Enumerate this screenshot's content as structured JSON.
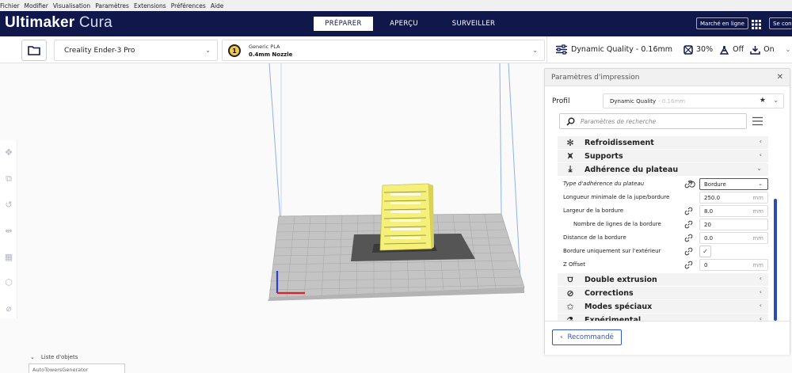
{
  "menu": [
    "Fichier",
    "Modifier",
    "Visualisation",
    "Paramètres",
    "Extensions",
    "Préférences",
    "Aide"
  ],
  "brand": {
    "name": "Ultimaker",
    "product": "Cura"
  },
  "stages": [
    {
      "label": "PRÉPARER",
      "active": true
    },
    {
      "label": "APERÇU",
      "active": false
    },
    {
      "label": "SURVEILLER",
      "active": false
    }
  ],
  "header_buttons": {
    "marketplace": "Marché en ligne",
    "signin": "Se conn"
  },
  "printer": {
    "name": "Creality Ender-3 Pro"
  },
  "material": {
    "extruder": "1",
    "name": "Generic PLA",
    "nozzle": "0.4mm Nozzle"
  },
  "print_summary": {
    "profile": "Dynamic Quality - 0.16mm",
    "infill": "30%",
    "support": "Off",
    "adhesion": "On"
  },
  "panel": {
    "title": "Paramètres d'impression",
    "profile_label": "Profil",
    "profile_value": "Dynamic Quality",
    "profile_suffix": "- 0.16mm",
    "search_placeholder": "Paramètres de recherche",
    "categories": [
      {
        "label": "Refroidissement",
        "icon": "fan-icon"
      },
      {
        "label": "Supports",
        "icon": "support-icon"
      },
      {
        "label": "Adhérence du plateau",
        "icon": "adhesion-icon"
      },
      {
        "label": "Double extrusion",
        "icon": "dual-extrusion-icon"
      },
      {
        "label": "Corrections",
        "icon": "corrections-icon"
      },
      {
        "label": "Modes spéciaux",
        "icon": "special-modes-icon"
      },
      {
        "label": "Expérimental",
        "icon": "experimental-icon"
      }
    ],
    "adhesion_settings": [
      {
        "label": "Type d'adhérence du plateau",
        "value": "Bordure",
        "unit": ""
      },
      {
        "label": "Longueur minimale de la jupe/bordure",
        "value": "250.0",
        "unit": "mm"
      },
      {
        "label": "Largeur de la bordure",
        "value": "8.0",
        "unit": "mm"
      },
      {
        "label": "Nombre de lignes de la bordure",
        "value": "20",
        "unit": ""
      },
      {
        "label": "Distance de la bordure",
        "value": "0.0",
        "unit": "mm"
      },
      {
        "label": "Bordure uniquement sur l'extérieur",
        "value": "✓",
        "unit": ""
      },
      {
        "label": "Z Offset",
        "value": "0",
        "unit": "mm"
      }
    ],
    "recommended_button": "Recommandé"
  },
  "object_list": {
    "label": "Liste d'objets",
    "item": "AutoTowersGenerator"
  },
  "colors": {
    "header": "#10174a",
    "accent": "#2f55c9",
    "model": "#f5f07a"
  }
}
